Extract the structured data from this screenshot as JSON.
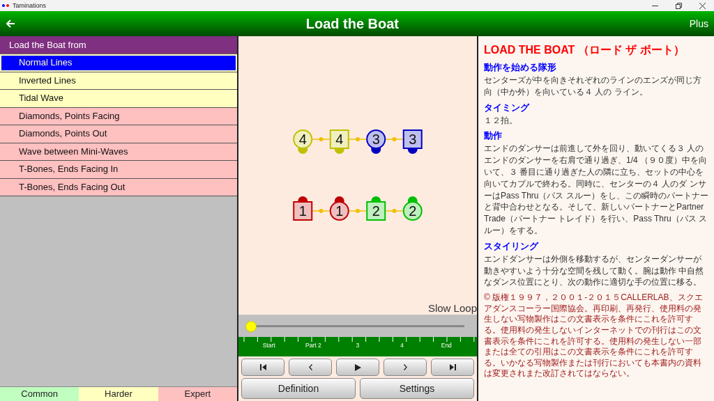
{
  "window": {
    "title": "Taminations"
  },
  "header": {
    "title": "Load the Boat",
    "right": "Plus"
  },
  "formations": {
    "title": "Load the Boat from",
    "items": [
      {
        "label": "Normal Lines",
        "color": "#ffffc0",
        "selected": true
      },
      {
        "label": "Inverted Lines",
        "color": "#ffffc0",
        "selected": false
      },
      {
        "label": "Tidal Wave",
        "color": "#ffffc0",
        "selected": false
      },
      {
        "label": "Diamonds, Points Facing",
        "color": "#ffc0c0",
        "selected": false
      },
      {
        "label": "Diamonds, Points Out",
        "color": "#ffc0c0",
        "selected": false
      },
      {
        "label": "Wave between Mini-Waves",
        "color": "#ffc0c0",
        "selected": false
      },
      {
        "label": "T-Bones, Ends Facing In",
        "color": "#ffc0c0",
        "selected": false
      },
      {
        "label": "T-Bones, Ends Facing Out",
        "color": "#ffc0c0",
        "selected": false
      }
    ]
  },
  "levels": [
    {
      "label": "Common",
      "color": "#c0ffc0"
    },
    {
      "label": "Harder",
      "color": "#ffffc0"
    },
    {
      "label": "Expert",
      "color": "#ffc0c0"
    }
  ],
  "animation": {
    "rows": [
      {
        "kind": "down",
        "dancers": [
          {
            "number": "4",
            "kind": "girl",
            "color": "#c0c000"
          },
          {
            "number": "4",
            "kind": "boy",
            "color": "#c0c000"
          },
          {
            "number": "3",
            "kind": "girl",
            "color": "#0000c0"
          },
          {
            "number": "3",
            "kind": "boy",
            "color": "#0000c0"
          }
        ]
      },
      {
        "kind": "up",
        "dancers": [
          {
            "number": "1",
            "kind": "boy",
            "color": "#c00000"
          },
          {
            "number": "1",
            "kind": "girl",
            "color": "#c00000"
          },
          {
            "number": "2",
            "kind": "boy",
            "color": "#00c000"
          },
          {
            "number": "2",
            "kind": "girl",
            "color": "#00c000"
          }
        ]
      }
    ],
    "loop_label": "Slow Loop",
    "slider": {
      "level": 0
    },
    "parts": [
      "Start",
      "Part 2",
      "3",
      "4",
      "End"
    ],
    "buttons": [
      "Definition",
      "Settings"
    ]
  },
  "definition": {
    "title": "LOAD THE BOAT （ロード ザ ボート）",
    "sections": [
      {
        "heading": "動作を始める隊形",
        "body": "センターズが中を向きそれぞれのラインのエンズが同じ方向（中か外）を向いている４ 人の ライン。"
      },
      {
        "heading": "タイミング",
        "body": "１２拍。"
      },
      {
        "heading": "動作",
        "body": "エンドのダンサーは前進して外を回り、動いてくる３ 人のエンドのダンサーを右肩で通り過ぎ、1/4 （９０度）中を向いて、３ 番目に通り過ぎた人の隣に立ち、セットの中心を向いてカプルで終わる。同時に、センターの４ 人のダ ンサーはPass Thru（パス スルー）をし、この瞬時のパートナーと背中合わせとなる。そして、新しいパートナーとPartner Trade（パートナー トレイド）を行い、Pass Thru（パス スルー）をする。"
      },
      {
        "heading": "スタイリング",
        "body": "エンドダンサーは外側を移動するが、センターダンサーが動きやすいよう十分な空間を残して動く。腕は動作 中自然なダンス位置にとり、次の動作に適切な手の位置に移る。"
      }
    ],
    "copyright": "© 版権１９９７，２００１-２０１５CALLERLAB、スクエアダンスコーラー国際協会。再印刷、再発行、使用料の発生しない写物製作はこの文書表示を条件にこれを許可する。使用料の発生しないインターネットでの刊行はこの文書表示を条件にこれを許可する。使用料の発生しない一部または全ての引用はこの文書表示を条件にこれを許可する。いかなる写物製作または刊行においても本書内の資料は変更されまた改訂されてはならない。"
  }
}
